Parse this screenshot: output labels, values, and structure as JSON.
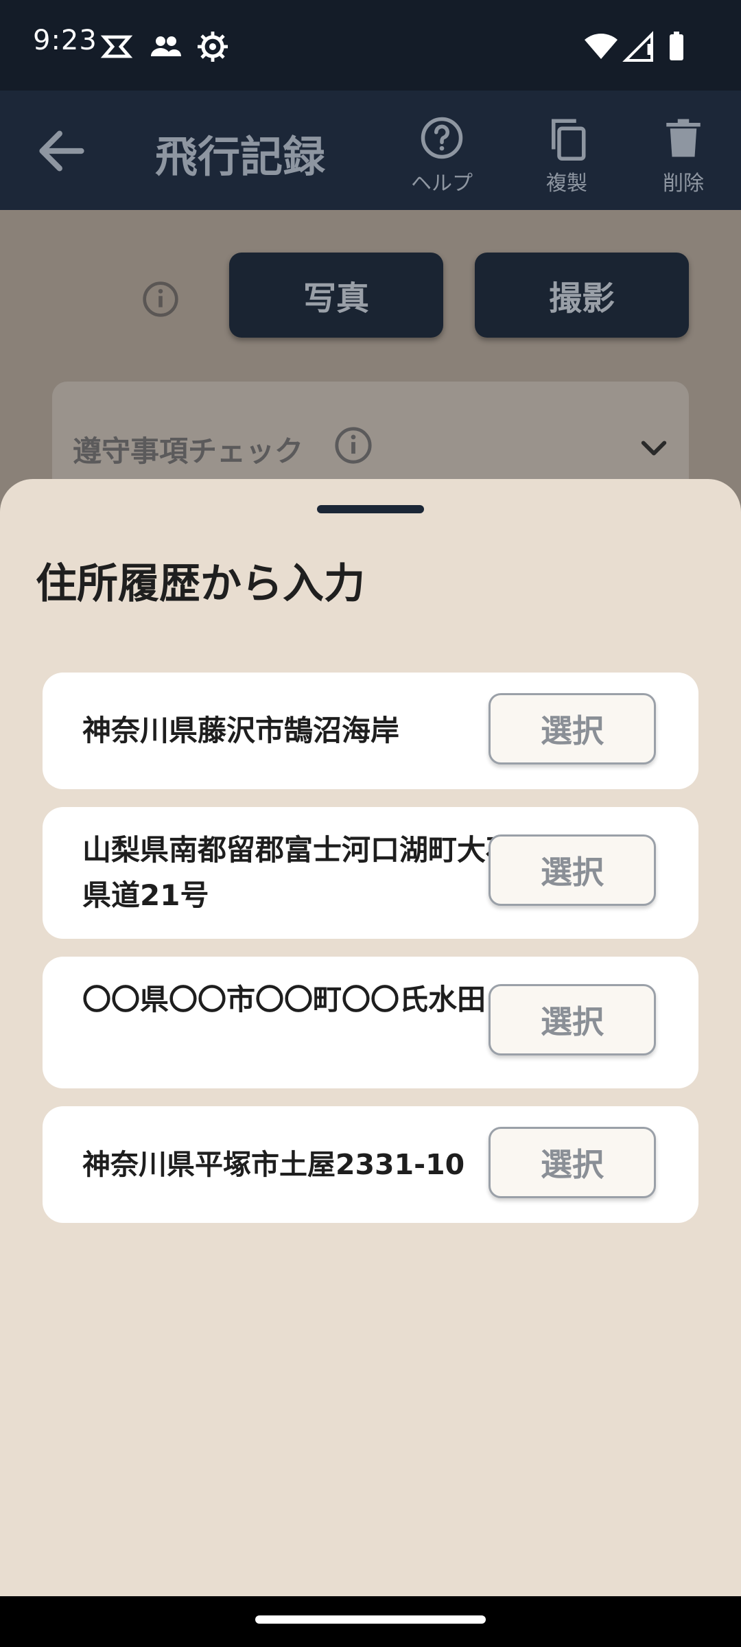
{
  "status": {
    "time": "9:23"
  },
  "appbar": {
    "title": "飛行記録",
    "actions": [
      {
        "label": "ヘルプ",
        "icon": "help-circle-icon"
      },
      {
        "label": "複製",
        "icon": "copy-icon"
      },
      {
        "label": "削除",
        "icon": "trash-icon"
      }
    ]
  },
  "content": {
    "photo_button": "写真",
    "capture_button": "撮影",
    "check_section": "遵守事項チェック"
  },
  "sheet": {
    "title": "住所履歴から入力",
    "items": [
      {
        "address": "神奈川県藤沢市鵠沼海岸",
        "button": "選択"
      },
      {
        "address": "山梨県南都留郡富士河口湖町大石 県道21号",
        "button": "選択"
      },
      {
        "address": "〇〇県〇〇市〇〇町〇〇氏水田",
        "button": "選択"
      },
      {
        "address": "神奈川県平塚市土屋2331-10",
        "button": "選択"
      }
    ]
  },
  "colors": {
    "appbar": "#1c2738",
    "sheet_bg": "#e8ddd0",
    "button_dark": "#1a2432"
  }
}
